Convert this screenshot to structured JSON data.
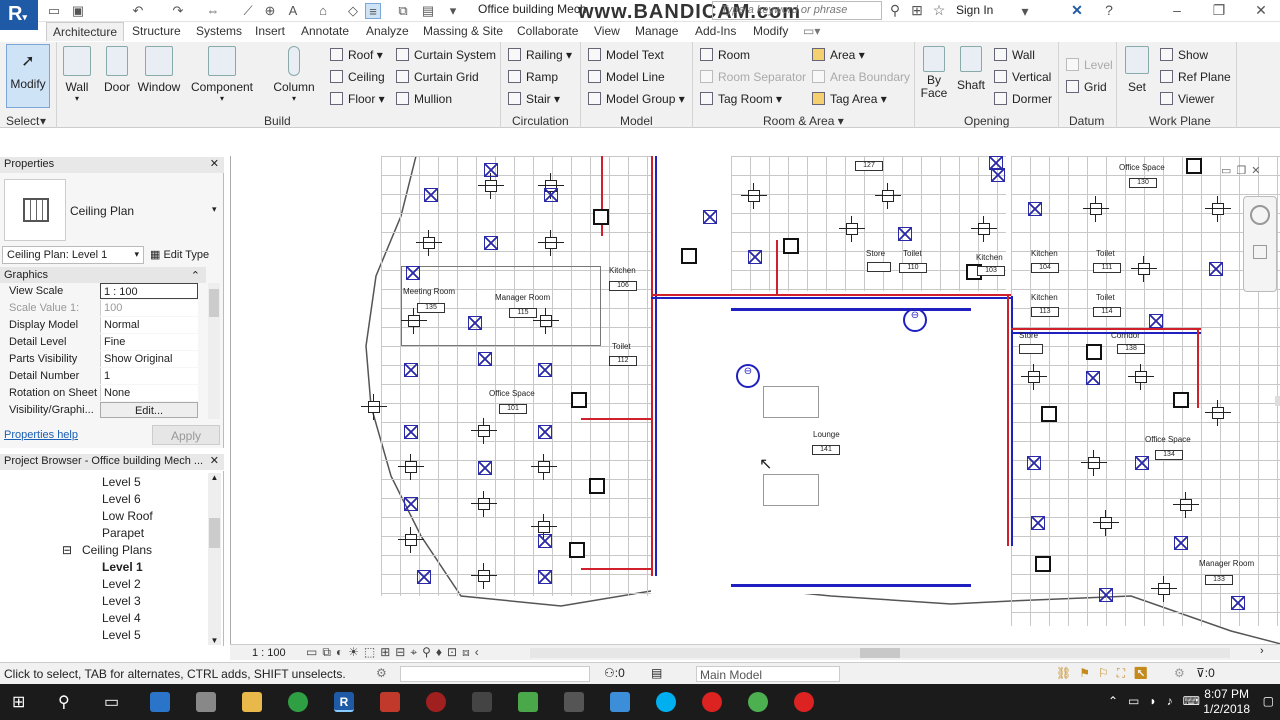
{
  "titlebar": {
    "doc_title": "Office building Mech",
    "watermark": "www.BANDICAM.com",
    "search_placeholder": "Type a keyword or phrase",
    "sign_in": "Sign In"
  },
  "tabs": [
    "Architecture",
    "Structure",
    "Systems",
    "Insert",
    "Annotate",
    "Analyze",
    "Massing & Site",
    "Collaborate",
    "View",
    "Manage",
    "Add-Ins",
    "Modify"
  ],
  "ribbon": {
    "modify": "Modify",
    "select": "Select",
    "build": {
      "label": "Build",
      "wall": "Wall",
      "door": "Door",
      "window": "Window",
      "component": "Component",
      "column": "Column",
      "roof": "Roof",
      "ceiling": "Ceiling",
      "floor": "Floor",
      "curtain_system": "Curtain System",
      "curtain_grid": "Curtain Grid",
      "mullion": "Mullion"
    },
    "circulation": {
      "label": "Circulation",
      "railing": "Railing",
      "ramp": "Ramp",
      "stair": "Stair"
    },
    "model": {
      "label": "Model",
      "model_text": "Model Text",
      "model_line": "Model Line",
      "model_group": "Model Group"
    },
    "room_area": {
      "label": "Room & Area",
      "room": "Room",
      "room_separator": "Room Separator",
      "tag_room": "Tag Room",
      "area": "Area",
      "area_boundary": "Area Boundary",
      "tag_area": "Tag Area"
    },
    "opening": {
      "label": "Opening",
      "by_face": "By Face",
      "shaft": "Shaft",
      "wall": "Wall",
      "vertical": "Vertical",
      "dormer": "Dormer"
    },
    "datum": {
      "label": "Datum",
      "level": "Level",
      "grid": "Grid"
    },
    "work_plane": {
      "label": "Work Plane",
      "set": "Set",
      "show": "Show",
      "ref_plane": "Ref Plane",
      "viewer": "Viewer"
    }
  },
  "properties": {
    "title": "Properties",
    "type_name": "Ceiling Plan",
    "instance": "Ceiling Plan: Level 1",
    "edit_type": "Edit Type",
    "group": "Graphics",
    "rows": [
      {
        "k": "View Scale",
        "v": "1 : 100"
      },
      {
        "k": "Scale Value    1:",
        "v": "100"
      },
      {
        "k": "Display Model",
        "v": "Normal"
      },
      {
        "k": "Detail Level",
        "v": "Fine"
      },
      {
        "k": "Parts Visibility",
        "v": "Show Original"
      },
      {
        "k": "Detail Number",
        "v": "1"
      },
      {
        "k": "Rotation on Sheet",
        "v": "None"
      },
      {
        "k": "Visibility/Graphi...",
        "v": "Edit..."
      }
    ],
    "help": "Properties help",
    "apply": "Apply"
  },
  "browser": {
    "title": "Project Browser - Office building Mech ...",
    "items": [
      "Level 5",
      "Level 6",
      "Low Roof",
      "Parapet",
      "Ceiling Plans",
      "Level 1",
      "Level 2",
      "Level 3",
      "Level 4",
      "Level 5"
    ]
  },
  "drawing": {
    "rooms": [
      {
        "name": "Meeting Room",
        "num": "135"
      },
      {
        "name": "Manager Room",
        "num": "115"
      },
      {
        "name": "Kitchen",
        "num": "106"
      },
      {
        "name": "Toilet",
        "num": "112"
      },
      {
        "name": "Office Space",
        "num": "101"
      },
      {
        "name": "Lounge",
        "num": "141"
      },
      {
        "name": "Store",
        "num": ""
      },
      {
        "name": "Toilet",
        "num": "110"
      },
      {
        "name": "Kitchen",
        "num": "103"
      },
      {
        "name": "Kitchen",
        "num": "104"
      },
      {
        "name": "Toilet",
        "num": "111"
      },
      {
        "name": "Kitchen",
        "num": "113"
      },
      {
        "name": "Toilet",
        "num": "114"
      },
      {
        "name": "Store",
        "num": ""
      },
      {
        "name": "Corridor",
        "num": "138"
      },
      {
        "name": "Office Space",
        "num": "130"
      },
      {
        "name": "Office Space",
        "num": "134"
      },
      {
        "name": "Manager Room",
        "num": "133"
      }
    ],
    "top_tag": "127"
  },
  "viewbar": {
    "scale": "1 : 100"
  },
  "status": {
    "hint": "Click to select, TAB for alternates, CTRL adds, SHIFT unselects.",
    "worksets": ":0",
    "model": "Main Model",
    "filter": ":0"
  },
  "clock": {
    "time": "8:07 PM",
    "date": "1/2/2018"
  }
}
